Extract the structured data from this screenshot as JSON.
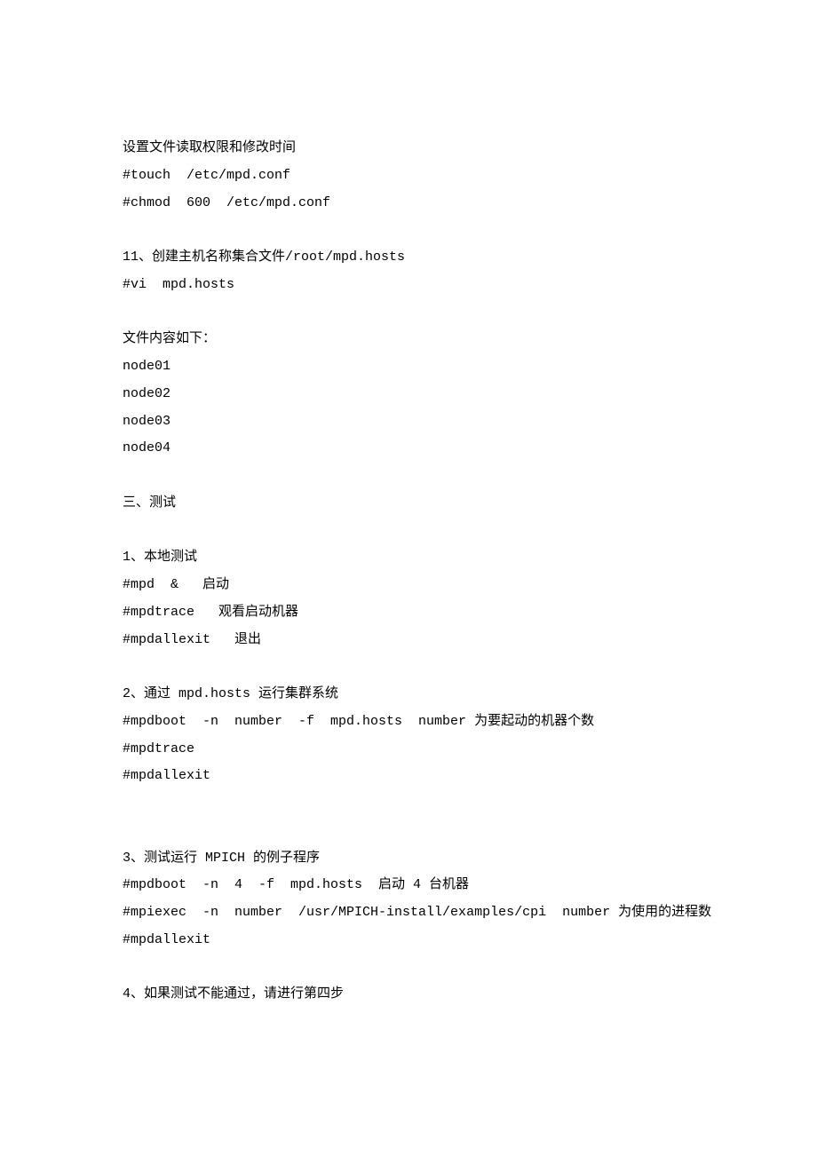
{
  "lines": [
    "设置文件读取权限和修改时间",
    "#touch  /etc/mpd.conf",
    "#chmod  600  /etc/mpd.conf",
    "",
    "11、创建主机名称集合文件/root/mpd.hosts",
    "#vi  mpd.hosts",
    "",
    "文件内容如下：",
    "node01",
    "node02",
    "node03",
    "node04",
    "",
    "三、测试",
    "",
    "1、本地测试",
    "#mpd  &   启动",
    "#mpdtrace   观看启动机器",
    "#mpdallexit   退出",
    "",
    "2、通过 mpd.hosts 运行集群系统",
    "#mpdboot  -n  number  -f  mpd.hosts  number 为要起动的机器个数",
    "#mpdtrace",
    "#mpdallexit",
    "",
    "",
    "3、测试运行 MPICH 的例子程序",
    "#mpdboot  -n  4  -f  mpd.hosts  启动 4 台机器",
    "#mpiexec  -n  number  /usr/MPICH-install/examples/cpi  number 为使用的进程数",
    "#mpdallexit",
    "",
    "4、如果测试不能通过，请进行第四步"
  ]
}
